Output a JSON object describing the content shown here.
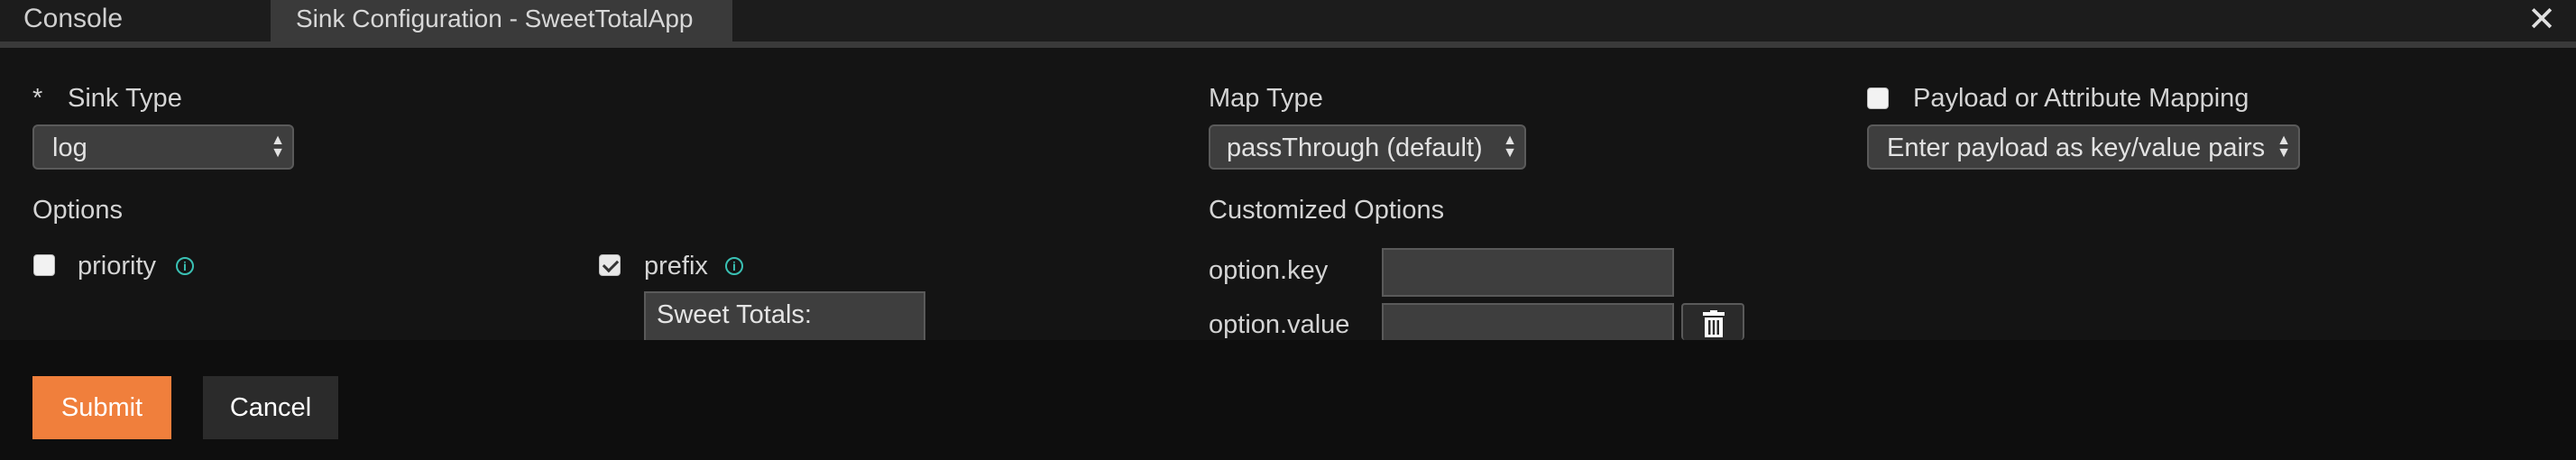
{
  "tabs": {
    "console_label": "Console",
    "active_label": "Sink Configuration - SweetTotalApp"
  },
  "close_label": "✕",
  "sink_type": {
    "required_marker": "*",
    "label": "Sink Type",
    "value": "log"
  },
  "options": {
    "label": "Options",
    "priority": {
      "label": "priority",
      "checked": false
    },
    "prefix": {
      "label": "prefix",
      "checked": true,
      "value": "Sweet Totals:"
    }
  },
  "map_type": {
    "label": "Map Type",
    "value": "passThrough (default)"
  },
  "customized_options": {
    "label": "Customized Options",
    "key_label": "option.key",
    "key_value": "",
    "value_label": "option.value",
    "value_value": ""
  },
  "payload_mapping": {
    "label": "Payload or Attribute Mapping",
    "checked": false,
    "value": "Enter payload as key/value pairs"
  },
  "footer": {
    "submit_label": "Submit",
    "cancel_label": "Cancel"
  },
  "colors": {
    "accent": "#f07f3c",
    "info": "#3ac1b4",
    "background": "#141414"
  }
}
